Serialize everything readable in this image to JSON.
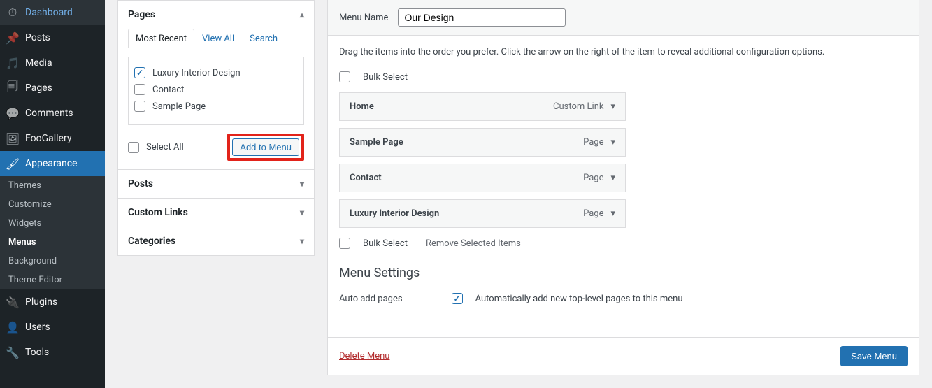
{
  "sidebar": {
    "items": [
      {
        "label": "Dashboard",
        "icon": "⌂"
      },
      {
        "label": "Posts",
        "icon": "📌"
      },
      {
        "label": "Media",
        "icon": "🖾"
      },
      {
        "label": "Pages",
        "icon": "🗐"
      },
      {
        "label": "Comments",
        "icon": "💬"
      },
      {
        "label": "FooGallery",
        "icon": "🖼"
      }
    ],
    "appearance": {
      "label": "Appearance",
      "icon": "🖌"
    },
    "sub_items": [
      {
        "label": "Themes"
      },
      {
        "label": "Customize"
      },
      {
        "label": "Widgets"
      },
      {
        "label": "Menus"
      },
      {
        "label": "Background"
      },
      {
        "label": "Theme Editor"
      }
    ],
    "items2": [
      {
        "label": "Plugins",
        "icon": "🔌"
      },
      {
        "label": "Users",
        "icon": "👤"
      },
      {
        "label": "Tools",
        "icon": "🔧"
      }
    ]
  },
  "accordion": {
    "pages_title": "Pages",
    "tabs": {
      "recent": "Most Recent",
      "view_all": "View All",
      "search": "Search"
    },
    "page_items": [
      {
        "label": "Luxury Interior Design",
        "checked": true
      },
      {
        "label": "Contact",
        "checked": false
      },
      {
        "label": "Sample Page",
        "checked": false
      }
    ],
    "select_all": "Select All",
    "add_to_menu": "Add to Menu",
    "posts_title": "Posts",
    "custom_links_title": "Custom Links",
    "categories_title": "Categories"
  },
  "menu": {
    "name_label": "Menu Name",
    "name_value": "Our Design",
    "instructions": "Drag the items into the order you prefer. Click the arrow on the right of the item to reveal additional configuration options.",
    "bulk_select": "Bulk Select",
    "remove_selected": "Remove Selected Items",
    "items": [
      {
        "title": "Home",
        "type": "Custom Link"
      },
      {
        "title": "Sample Page",
        "type": "Page"
      },
      {
        "title": "Contact",
        "type": "Page"
      },
      {
        "title": "Luxury Interior Design",
        "type": "Page"
      }
    ],
    "settings_heading": "Menu Settings",
    "auto_add_label": "Auto add pages",
    "auto_add_desc": "Automatically add new top-level pages to this menu",
    "delete_menu": "Delete Menu",
    "save_menu": "Save Menu"
  }
}
